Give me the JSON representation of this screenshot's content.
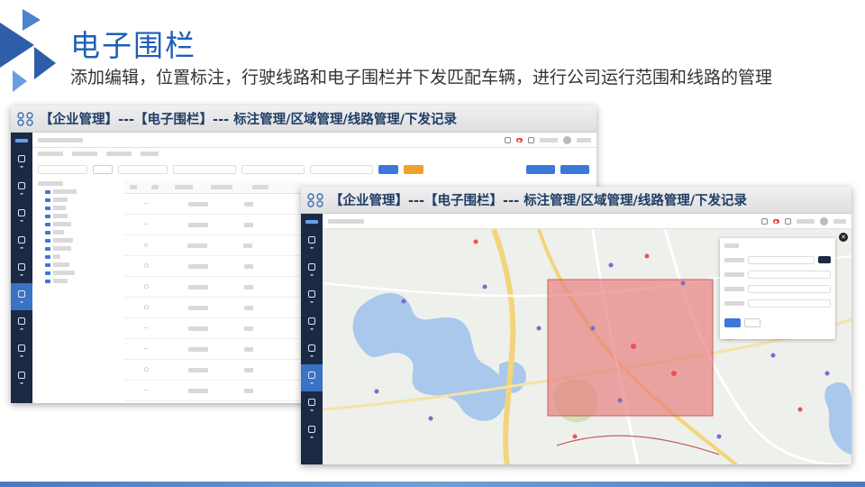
{
  "slide": {
    "title": "电子围栏",
    "subtitle": "添加编辑，位置标注，行驶线路和电子围栏并下发匹配车辆，进行公司运行范围和线路的管理"
  },
  "panel_left": {
    "header": "【企业管理】---【电子围栏】---  标注管理/区域管理/线路管理/下发记录"
  },
  "panel_right": {
    "header": "【企业管理】---【电子围栏】---  标注管理/区域管理/线路管理/下发记录"
  },
  "colors": {
    "title": "#1e5fb4",
    "header_text": "#1f3c66",
    "sidebar": "#1a2a44",
    "sidebar_active": "#3a72c4",
    "fence_fill": "#e88080",
    "water": "#a9c8ec",
    "primary_button": "#3b78d8",
    "warning_button": "#f0a030"
  },
  "icons": [
    "nodes-icon",
    "close-icon",
    "folder-icon"
  ]
}
